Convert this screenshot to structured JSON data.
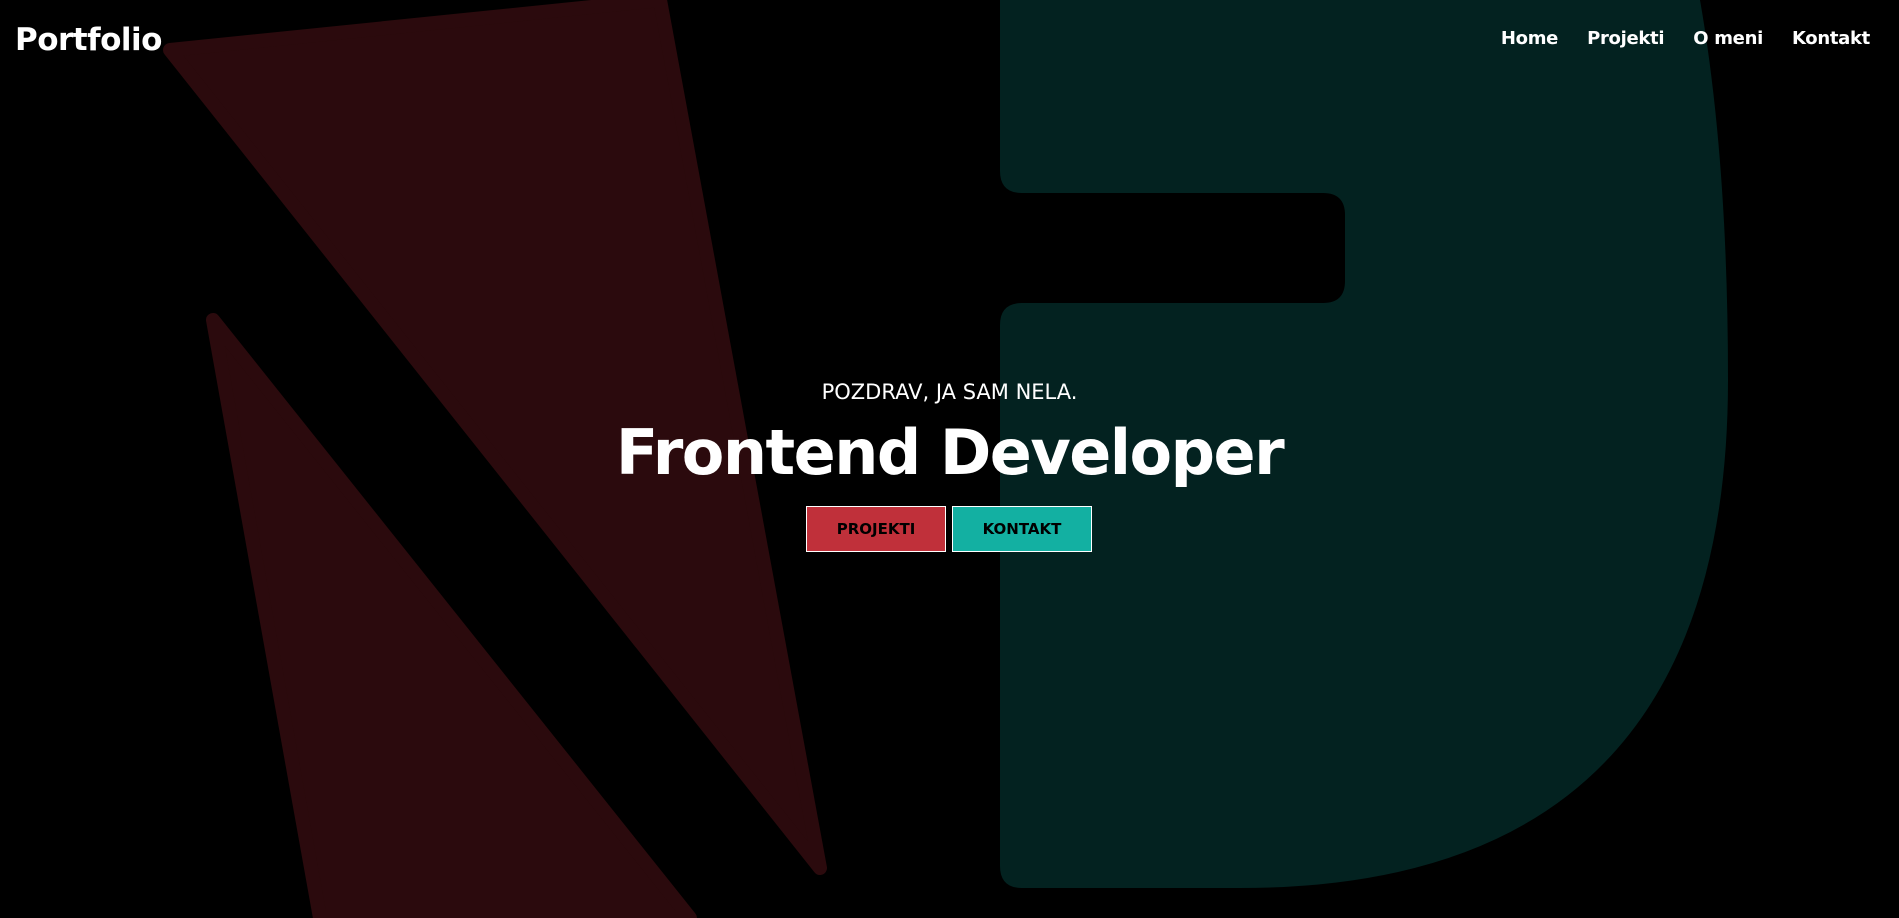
{
  "colors": {
    "background": "#000000",
    "accent_red": "#c0303a",
    "accent_teal": "#13b0a2",
    "shape_red": "#2b0a0d",
    "shape_teal": "#032220",
    "text": "#ffffff",
    "button_text": "#000000"
  },
  "brand": {
    "logo": "Portfolio"
  },
  "nav": {
    "items": [
      {
        "label": "Home"
      },
      {
        "label": "Projekti"
      },
      {
        "label": "O meni"
      },
      {
        "label": "Kontakt"
      }
    ]
  },
  "hero": {
    "greeting": "POZDRAV, JA SAM NELA.",
    "title": "Frontend Developer",
    "buttons": [
      {
        "label": "PROJEKTI",
        "color": "#c0303a"
      },
      {
        "label": "KONTAKT",
        "color": "#13b0a2"
      }
    ]
  }
}
